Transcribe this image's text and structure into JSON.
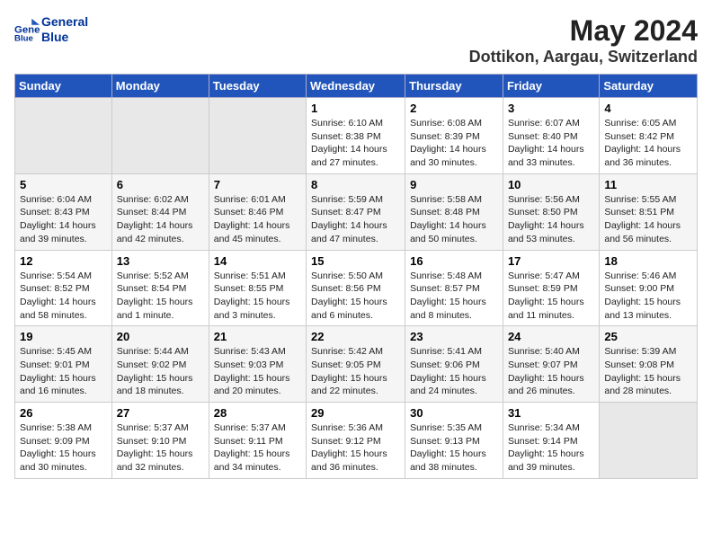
{
  "logo": {
    "line1": "General",
    "line2": "Blue"
  },
  "title": "May 2024",
  "subtitle": "Dottikon, Aargau, Switzerland",
  "weekdays": [
    "Sunday",
    "Monday",
    "Tuesday",
    "Wednesday",
    "Thursday",
    "Friday",
    "Saturday"
  ],
  "weeks": [
    [
      {
        "day": "",
        "info": ""
      },
      {
        "day": "",
        "info": ""
      },
      {
        "day": "",
        "info": ""
      },
      {
        "day": "1",
        "info": "Sunrise: 6:10 AM\nSunset: 8:38 PM\nDaylight: 14 hours\nand 27 minutes."
      },
      {
        "day": "2",
        "info": "Sunrise: 6:08 AM\nSunset: 8:39 PM\nDaylight: 14 hours\nand 30 minutes."
      },
      {
        "day": "3",
        "info": "Sunrise: 6:07 AM\nSunset: 8:40 PM\nDaylight: 14 hours\nand 33 minutes."
      },
      {
        "day": "4",
        "info": "Sunrise: 6:05 AM\nSunset: 8:42 PM\nDaylight: 14 hours\nand 36 minutes."
      }
    ],
    [
      {
        "day": "5",
        "info": "Sunrise: 6:04 AM\nSunset: 8:43 PM\nDaylight: 14 hours\nand 39 minutes."
      },
      {
        "day": "6",
        "info": "Sunrise: 6:02 AM\nSunset: 8:44 PM\nDaylight: 14 hours\nand 42 minutes."
      },
      {
        "day": "7",
        "info": "Sunrise: 6:01 AM\nSunset: 8:46 PM\nDaylight: 14 hours\nand 45 minutes."
      },
      {
        "day": "8",
        "info": "Sunrise: 5:59 AM\nSunset: 8:47 PM\nDaylight: 14 hours\nand 47 minutes."
      },
      {
        "day": "9",
        "info": "Sunrise: 5:58 AM\nSunset: 8:48 PM\nDaylight: 14 hours\nand 50 minutes."
      },
      {
        "day": "10",
        "info": "Sunrise: 5:56 AM\nSunset: 8:50 PM\nDaylight: 14 hours\nand 53 minutes."
      },
      {
        "day": "11",
        "info": "Sunrise: 5:55 AM\nSunset: 8:51 PM\nDaylight: 14 hours\nand 56 minutes."
      }
    ],
    [
      {
        "day": "12",
        "info": "Sunrise: 5:54 AM\nSunset: 8:52 PM\nDaylight: 14 hours\nand 58 minutes."
      },
      {
        "day": "13",
        "info": "Sunrise: 5:52 AM\nSunset: 8:54 PM\nDaylight: 15 hours\nand 1 minute."
      },
      {
        "day": "14",
        "info": "Sunrise: 5:51 AM\nSunset: 8:55 PM\nDaylight: 15 hours\nand 3 minutes."
      },
      {
        "day": "15",
        "info": "Sunrise: 5:50 AM\nSunset: 8:56 PM\nDaylight: 15 hours\nand 6 minutes."
      },
      {
        "day": "16",
        "info": "Sunrise: 5:48 AM\nSunset: 8:57 PM\nDaylight: 15 hours\nand 8 minutes."
      },
      {
        "day": "17",
        "info": "Sunrise: 5:47 AM\nSunset: 8:59 PM\nDaylight: 15 hours\nand 11 minutes."
      },
      {
        "day": "18",
        "info": "Sunrise: 5:46 AM\nSunset: 9:00 PM\nDaylight: 15 hours\nand 13 minutes."
      }
    ],
    [
      {
        "day": "19",
        "info": "Sunrise: 5:45 AM\nSunset: 9:01 PM\nDaylight: 15 hours\nand 16 minutes."
      },
      {
        "day": "20",
        "info": "Sunrise: 5:44 AM\nSunset: 9:02 PM\nDaylight: 15 hours\nand 18 minutes."
      },
      {
        "day": "21",
        "info": "Sunrise: 5:43 AM\nSunset: 9:03 PM\nDaylight: 15 hours\nand 20 minutes."
      },
      {
        "day": "22",
        "info": "Sunrise: 5:42 AM\nSunset: 9:05 PM\nDaylight: 15 hours\nand 22 minutes."
      },
      {
        "day": "23",
        "info": "Sunrise: 5:41 AM\nSunset: 9:06 PM\nDaylight: 15 hours\nand 24 minutes."
      },
      {
        "day": "24",
        "info": "Sunrise: 5:40 AM\nSunset: 9:07 PM\nDaylight: 15 hours\nand 26 minutes."
      },
      {
        "day": "25",
        "info": "Sunrise: 5:39 AM\nSunset: 9:08 PM\nDaylight: 15 hours\nand 28 minutes."
      }
    ],
    [
      {
        "day": "26",
        "info": "Sunrise: 5:38 AM\nSunset: 9:09 PM\nDaylight: 15 hours\nand 30 minutes."
      },
      {
        "day": "27",
        "info": "Sunrise: 5:37 AM\nSunset: 9:10 PM\nDaylight: 15 hours\nand 32 minutes."
      },
      {
        "day": "28",
        "info": "Sunrise: 5:37 AM\nSunset: 9:11 PM\nDaylight: 15 hours\nand 34 minutes."
      },
      {
        "day": "29",
        "info": "Sunrise: 5:36 AM\nSunset: 9:12 PM\nDaylight: 15 hours\nand 36 minutes."
      },
      {
        "day": "30",
        "info": "Sunrise: 5:35 AM\nSunset: 9:13 PM\nDaylight: 15 hours\nand 38 minutes."
      },
      {
        "day": "31",
        "info": "Sunrise: 5:34 AM\nSunset: 9:14 PM\nDaylight: 15 hours\nand 39 minutes."
      },
      {
        "day": "",
        "info": ""
      }
    ]
  ]
}
